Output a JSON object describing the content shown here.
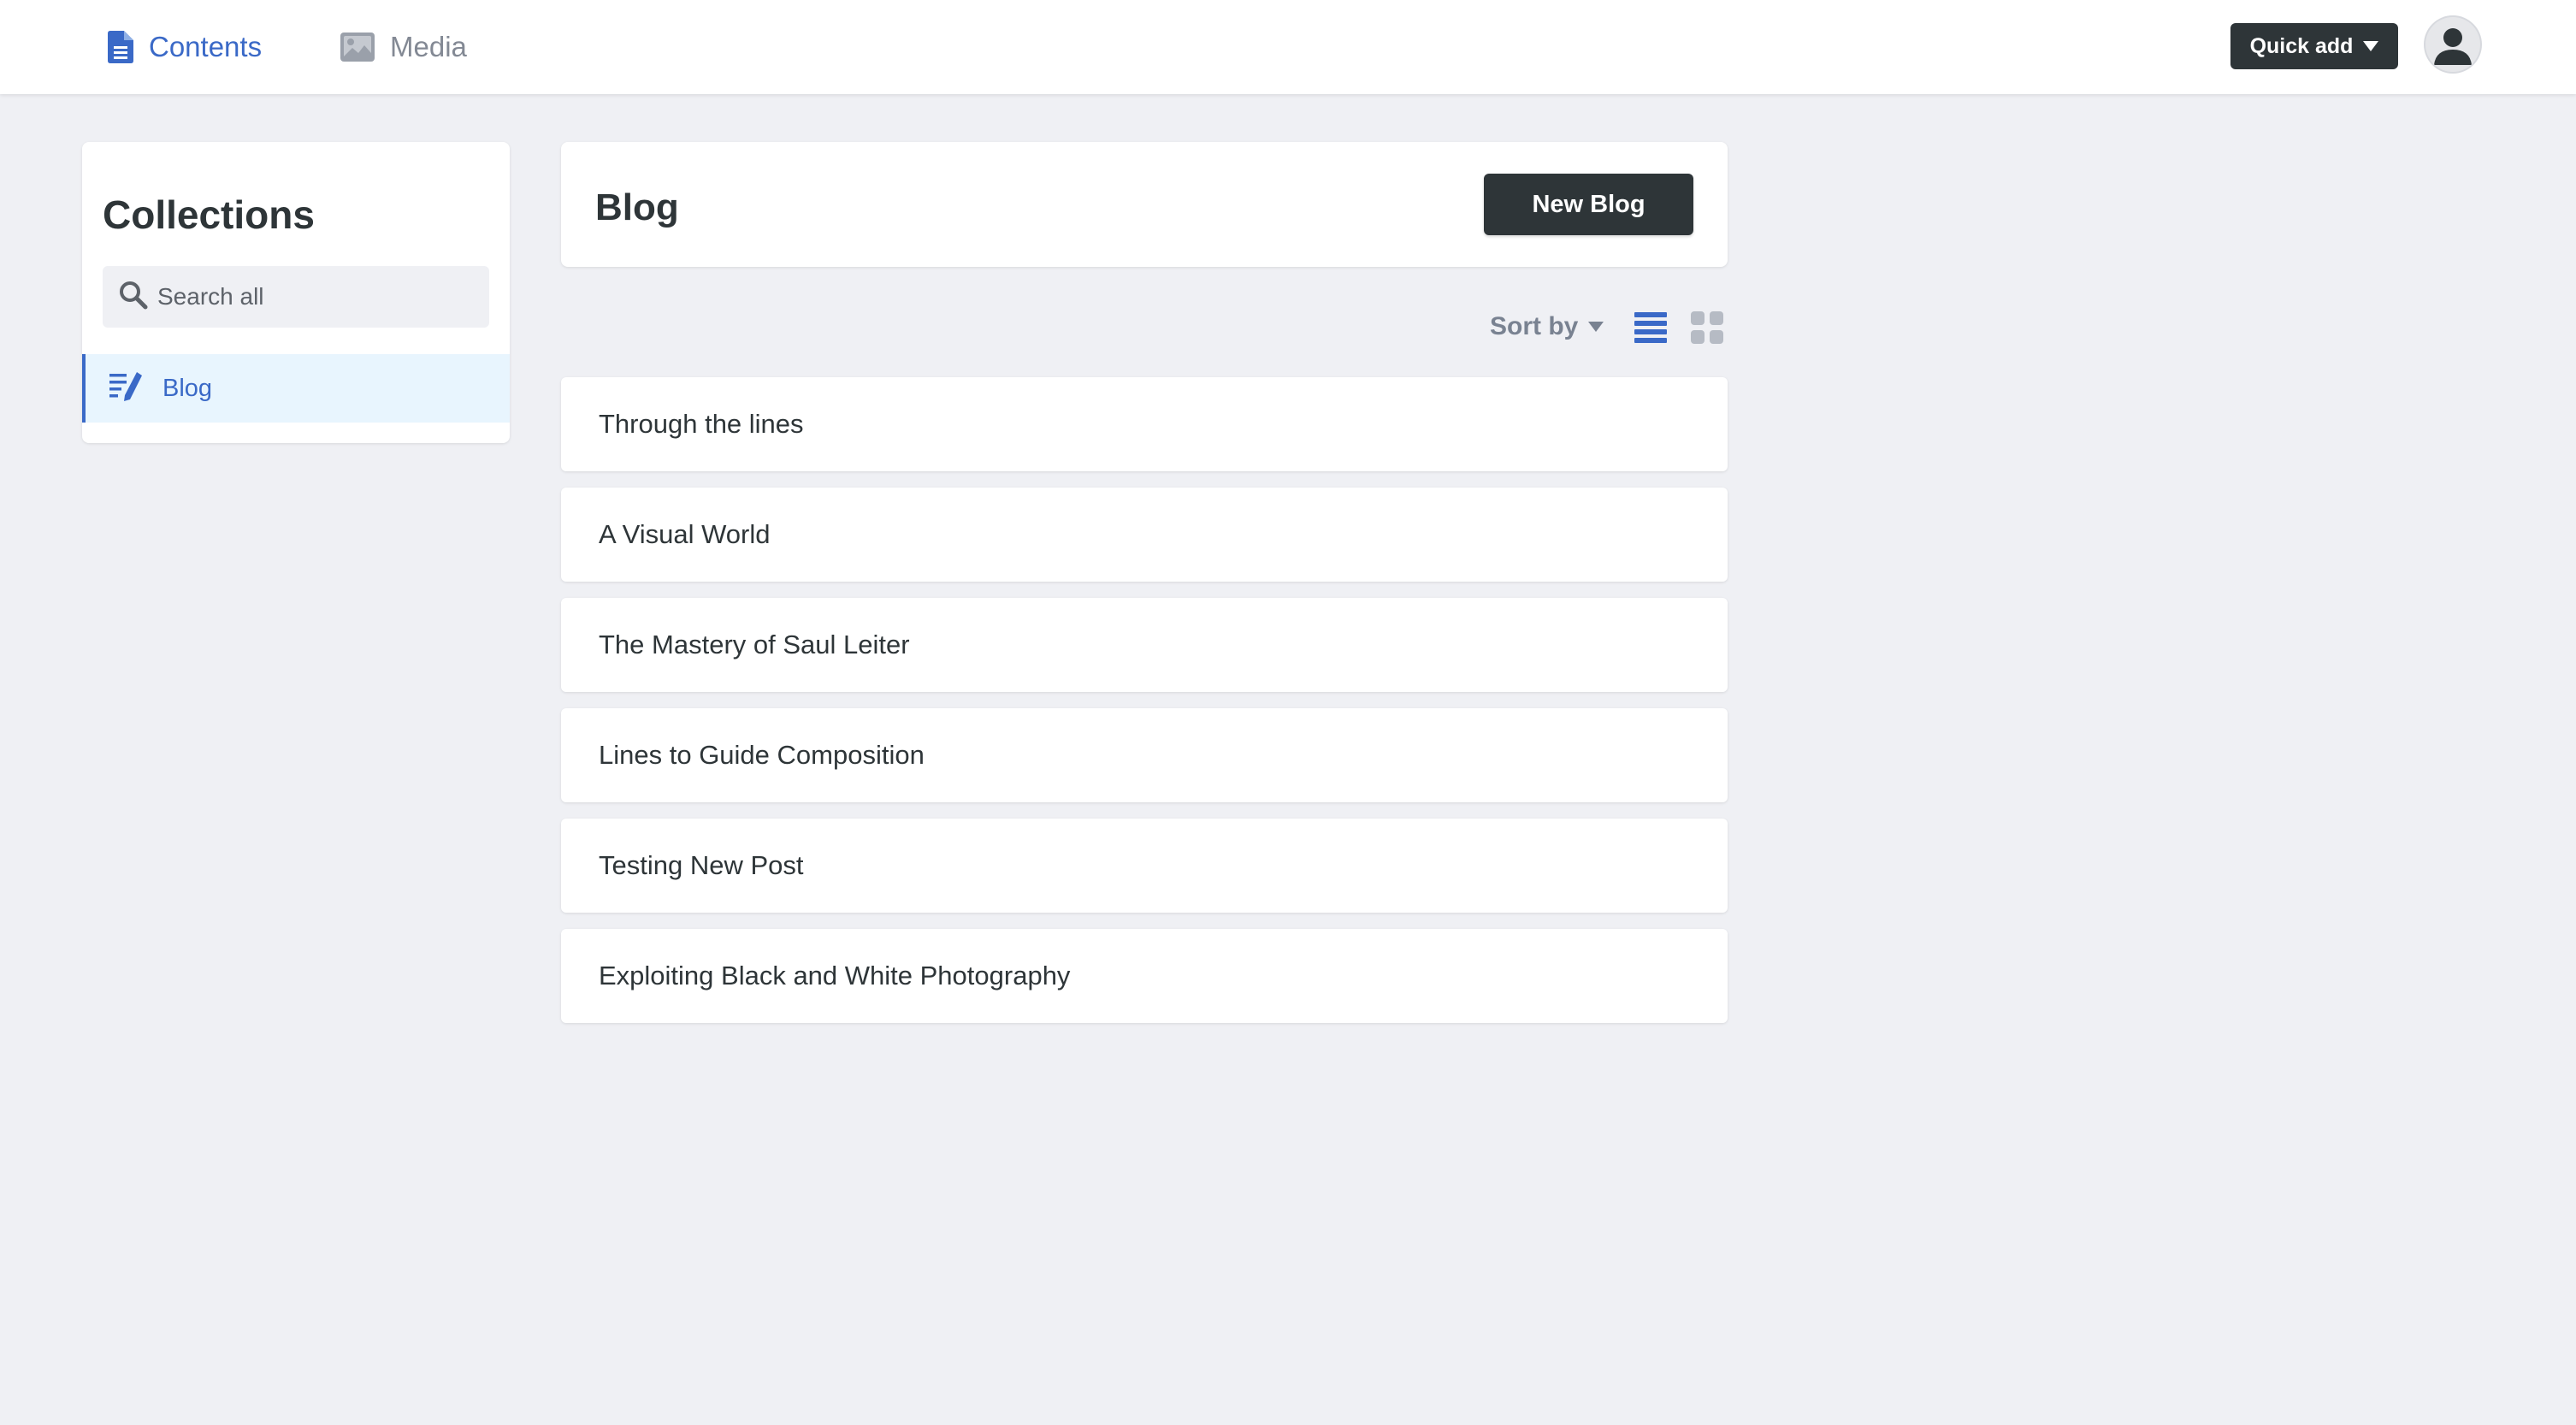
{
  "topnav": {
    "contents_label": "Contents",
    "media_label": "Media",
    "quick_add_label": "Quick add"
  },
  "sidebar": {
    "title": "Collections",
    "search_placeholder": "Search all",
    "items": [
      {
        "label": "Blog",
        "icon": "write-icon",
        "active": true
      }
    ]
  },
  "main": {
    "title": "Blog",
    "new_button_label": "New Blog",
    "sort_label": "Sort by",
    "view_mode": "list",
    "entries": [
      "Through the lines",
      "A Visual World",
      "The Mastery of Saul Leiter",
      "Lines to Guide Composition",
      "Testing New Post",
      "Exploiting Black and White Photography"
    ]
  },
  "colors": {
    "accent": "#3a69c7",
    "dark_button": "#2e3538",
    "page_background": "#eff0f4",
    "active_item_background": "#e8f5fe",
    "muted_text": "#798291"
  }
}
